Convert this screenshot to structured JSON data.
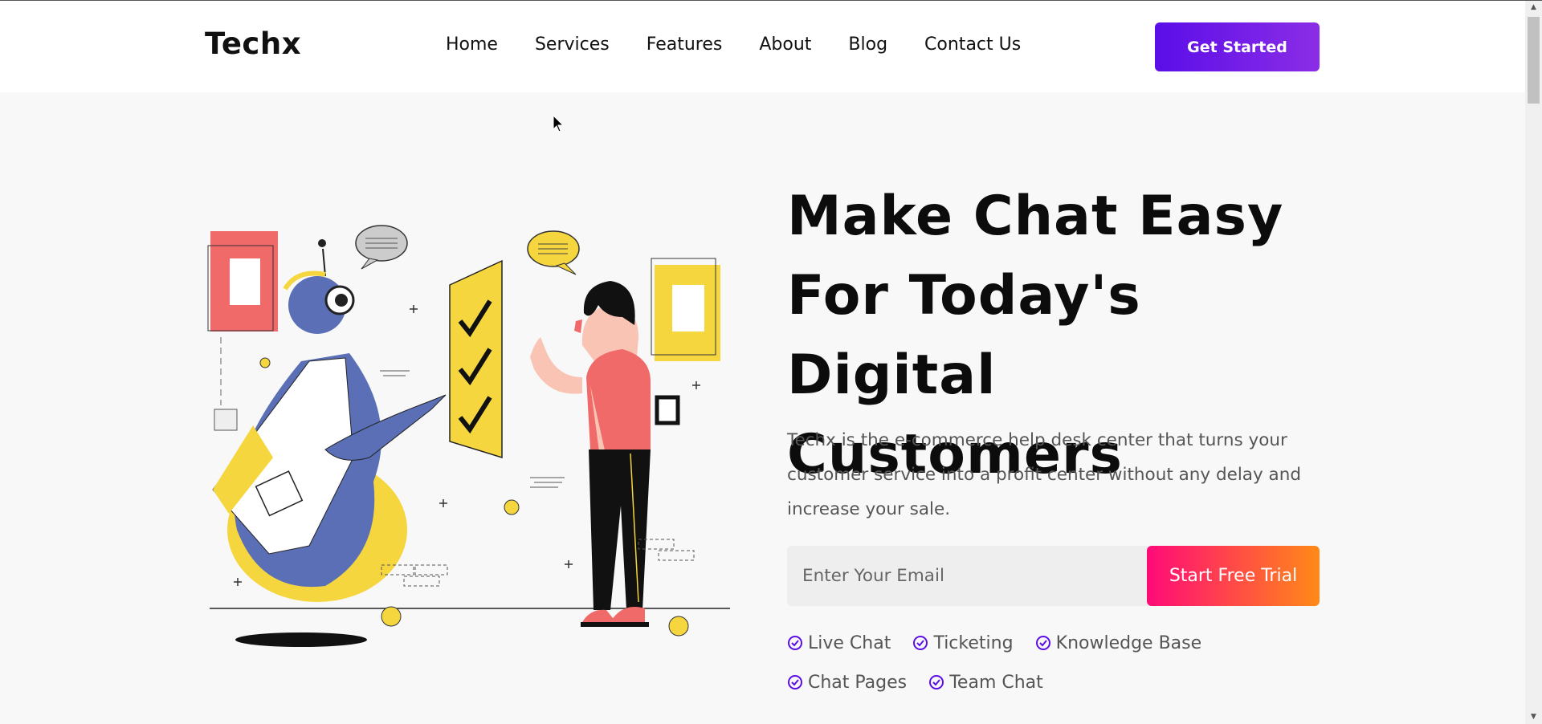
{
  "header": {
    "logo": "Techx",
    "nav": [
      "Home",
      "Services",
      "Features",
      "About",
      "Blog",
      "Contact Us"
    ],
    "cta_label": "Get Started"
  },
  "hero": {
    "title_lines": [
      "Make Chat Easy",
      "For Today's Digital",
      "Customers"
    ],
    "description": "Techx is the e-commerce help desk center that turns your customer service into a profit center without any delay and increase your sale.",
    "email_placeholder": "Enter Your Email",
    "submit_label": "Start Free Trial",
    "features": [
      "Live Chat",
      "Ticketing",
      "Knowledge Base",
      "Chat Pages",
      "Team Chat"
    ]
  },
  "colors": {
    "accent_purple": "#5b0ee8",
    "accent_pink": "#ff0a78",
    "accent_orange": "#ff8a17",
    "background": "#f8f8f8"
  },
  "icons": {
    "feature_check": "check-circle-icon",
    "cursor": "mouse-pointer-icon"
  }
}
